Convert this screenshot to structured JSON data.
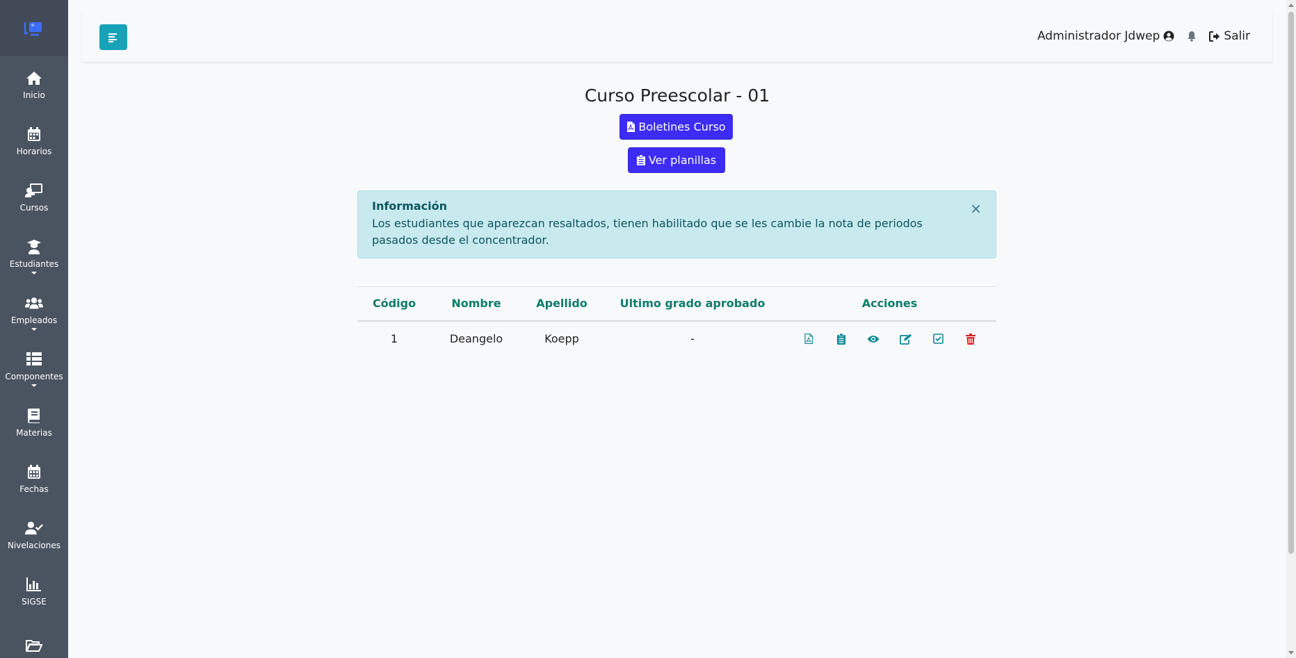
{
  "sidebar": {
    "items": [
      {
        "label": "Inicio",
        "icon": "home-icon"
      },
      {
        "label": "Horarios",
        "icon": "calendar-icon"
      },
      {
        "label": "Cursos",
        "icon": "chalkboard-teacher-icon"
      },
      {
        "label": "Estudiantes",
        "icon": "graduate-icon",
        "has_submenu": true
      },
      {
        "label": "Empleados",
        "icon": "users-icon",
        "has_submenu": true
      },
      {
        "label": "Componentes",
        "icon": "th-list-icon",
        "has_submenu": true
      },
      {
        "label": "Materias",
        "icon": "book-icon"
      },
      {
        "label": "Fechas",
        "icon": "calendar-alt-icon"
      },
      {
        "label": "Nivelaciones",
        "icon": "user-check-icon"
      },
      {
        "label": "SIGSE",
        "icon": "chart-bar-icon"
      },
      {
        "label": "",
        "icon": "folder-open-icon"
      }
    ]
  },
  "header": {
    "user_name": "Administrador Jdwep",
    "logout_label": "Salir"
  },
  "main": {
    "title": "Curso Preescolar - 01",
    "boletines_label": "Boletines Curso",
    "planillas_label": "Ver planillas"
  },
  "alert": {
    "title": "Información",
    "text": "Los estudiantes que aparezcan resaltados, tienen habilitado que se les cambie la nota de periodos pasados desde el concentrador.",
    "close": "×"
  },
  "table": {
    "headers": [
      "Código",
      "Nombre",
      "Apellido",
      "Ultimo grado aprobado",
      "Acciones"
    ],
    "rows": [
      {
        "codigo": "1",
        "nombre": "Deangelo",
        "apellido": "Koepp",
        "ultimo_grado": "-"
      }
    ]
  },
  "colors": {
    "sidebar_bg": "#4a5461",
    "accent_teal": "#17a2b8",
    "primary_button": "#3d2cf5",
    "table_header": "#0d7c6c",
    "action_icon": "#0f8a99",
    "delete_icon": "#d9232d"
  }
}
